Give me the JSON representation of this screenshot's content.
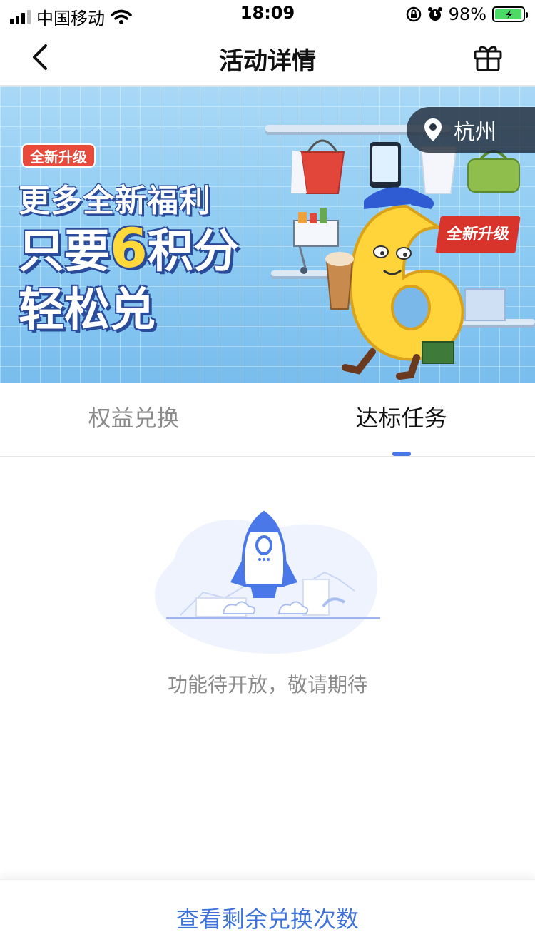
{
  "status_bar": {
    "carrier": "中国移动",
    "time": "18:09",
    "battery_percent": "98%",
    "battery_level": 0.98,
    "icons": [
      "signal-icon",
      "wifi-icon",
      "orientation-lock-icon",
      "alarm-icon",
      "battery-icon"
    ]
  },
  "nav": {
    "title": "活动详情",
    "back_icon": "chevron-left-icon",
    "gift_icon": "gift-icon"
  },
  "banner": {
    "badge": "全新升级",
    "line1": "更多全新福利",
    "line2_prefix": "只要",
    "line2_number": "6",
    "line2_suffix": "积分",
    "line3": "轻松兑",
    "rack_tag": "全新升级",
    "location": "杭州",
    "location_icon": "map-pin-icon",
    "colors": {
      "sky": "#8ccaf2",
      "highlight": "#ffd83a",
      "outline": "#2a4a9a",
      "tag": "#e84a3c"
    }
  },
  "tabs": [
    {
      "label": "权益兑换",
      "active": false
    },
    {
      "label": "达标任务",
      "active": true
    }
  ],
  "empty_state": {
    "message": "功能待开放，敬请期待",
    "illustration": "rocket-illustration"
  },
  "bottom": {
    "button_label": "查看剩余兑换次数"
  },
  "colors": {
    "accent": "#4a78e8",
    "link": "#3c72d9",
    "muted_text": "#8a8a8a"
  }
}
